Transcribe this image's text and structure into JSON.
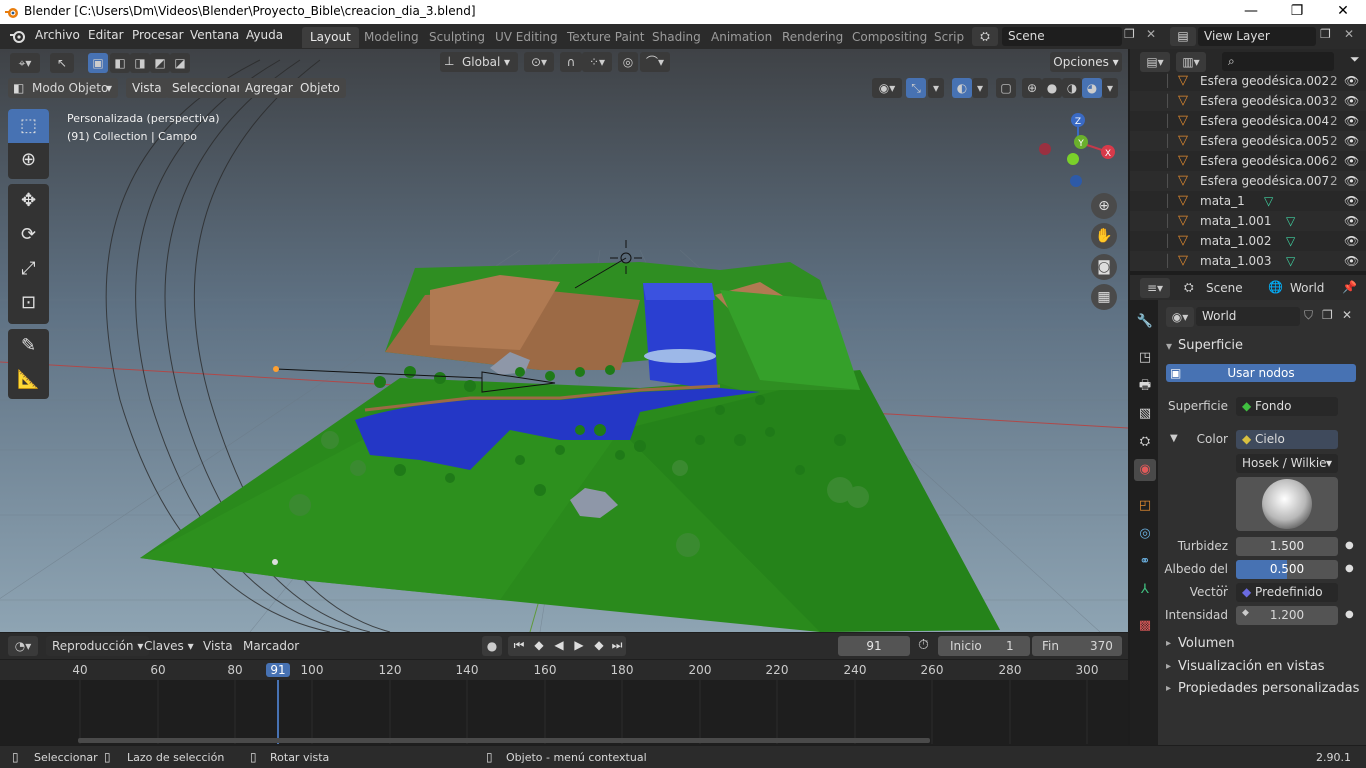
{
  "window": {
    "title": "Blender [C:\\Users\\Dm\\Videos\\Blender\\Proyecto_Bible\\creacion_dia_3.blend]",
    "minimize": "—",
    "maximize": "❐",
    "close": "✕"
  },
  "menus": [
    "Archivo",
    "Editar",
    "Procesar",
    "Ventana",
    "Ayuda"
  ],
  "workspaces": [
    "Layout",
    "Modeling",
    "Sculpting",
    "UV Editing",
    "Texture Paint",
    "Shading",
    "Animation",
    "Rendering",
    "Compositing",
    "Script"
  ],
  "scene": {
    "name": "Scene",
    "view_layer": "View Layer"
  },
  "viewport": {
    "transform": "Global",
    "options": "Opciones",
    "mode": "Modo Objeto",
    "menus": [
      "Vista",
      "Seleccionar",
      "Agregar",
      "Objeto"
    ],
    "overlay_line1": "Personalizada (perspectiva)",
    "overlay_line2": "(91) Collection | Campo",
    "axis_x": "X",
    "axis_y": "Y",
    "axis_z": "Z"
  },
  "timeline": {
    "playback": "Reproducción",
    "keys": "Claves",
    "view": "Vista",
    "marker": "Marcador",
    "current_frame": "91",
    "start_label": "Inicio",
    "start": "1",
    "end_label": "Fin",
    "end": "370",
    "ticks": [
      "40",
      "60",
      "80",
      "91",
      "100",
      "120",
      "140",
      "160",
      "180",
      "200",
      "220",
      "240",
      "260",
      "280",
      "300"
    ]
  },
  "outliner": {
    "items": [
      {
        "name": "Esfera geodésica.002",
        "suffix": "2"
      },
      {
        "name": "Esfera geodésica.003",
        "suffix": "2"
      },
      {
        "name": "Esfera geodésica.004",
        "suffix": "2"
      },
      {
        "name": "Esfera geodésica.005",
        "suffix": "2"
      },
      {
        "name": "Esfera geodésica.006",
        "suffix": "2"
      },
      {
        "name": "Esfera geodésica.007",
        "suffix": "2"
      },
      {
        "name": "mata_1",
        "suffix": ""
      },
      {
        "name": "mata_1.001",
        "suffix": ""
      },
      {
        "name": "mata_1.002",
        "suffix": ""
      },
      {
        "name": "mata_1.003",
        "suffix": ""
      }
    ]
  },
  "properties": {
    "crumb_scene": "Scene",
    "crumb_world": "World",
    "world_name": "World",
    "surface_section": "Superficie",
    "use_nodes": "Usar nodos",
    "surface_label": "Superficie",
    "surface_value": "Fondo",
    "color_label": "Color",
    "color_value": "Cielo",
    "sky_type": "Hosek / Wilkie",
    "turbidity_label": "Turbidez",
    "turbidity": "1.500",
    "albedo_label": "Albedo del ...",
    "albedo": "0.500",
    "albedo_fraction": 0.5,
    "vector_label": "Vector",
    "vector_value": "Predefinido",
    "intensity_label": "Intensidad",
    "intensity": "1.200",
    "collapsed": [
      "Volumen",
      "Visualización en vistas",
      "Propiedades personalizadas"
    ]
  },
  "status": {
    "select": "Seleccionar",
    "lasso": "Lazo de selección",
    "rotate": "Rotar vista",
    "context": "Objeto - menú contextual",
    "version": "2.90.1"
  },
  "colors": {
    "accent": "#4772b3",
    "grass": "#2a8a1c",
    "water": "#2a3fd1",
    "soil": "#9c6a45"
  }
}
